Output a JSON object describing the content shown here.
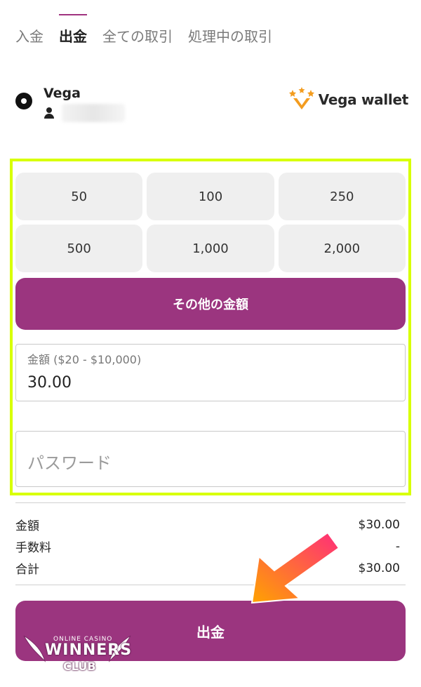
{
  "tabs": [
    "入金",
    "出金",
    "全ての取引",
    "処理中の取引"
  ],
  "active_tab": "出金",
  "method": {
    "name": "Vega",
    "brand": "Vega wallet",
    "selected": true
  },
  "amount_options": [
    "50",
    "100",
    "250",
    "500",
    "1,000",
    "2,000"
  ],
  "other_amount_label": "その他の金額",
  "amount_field": {
    "label": "金額 ($20 - $10,000)",
    "value": "30.00"
  },
  "password_field": {
    "placeholder": "パスワード"
  },
  "summary": [
    {
      "label": "金額",
      "value": "$30.00"
    },
    {
      "label": "手数料",
      "value": "-"
    },
    {
      "label": "合計",
      "value": "$30.00"
    }
  ],
  "submit_label": "出金",
  "watermark": {
    "top": "ONLINE CASINO",
    "main": "WINNERS",
    "sub": "CLUB"
  },
  "colors": {
    "accent": "#9b357f",
    "highlight": "#d8ff00",
    "arrow_start": "#ff9a00",
    "arrow_end": "#ff2d7a"
  }
}
